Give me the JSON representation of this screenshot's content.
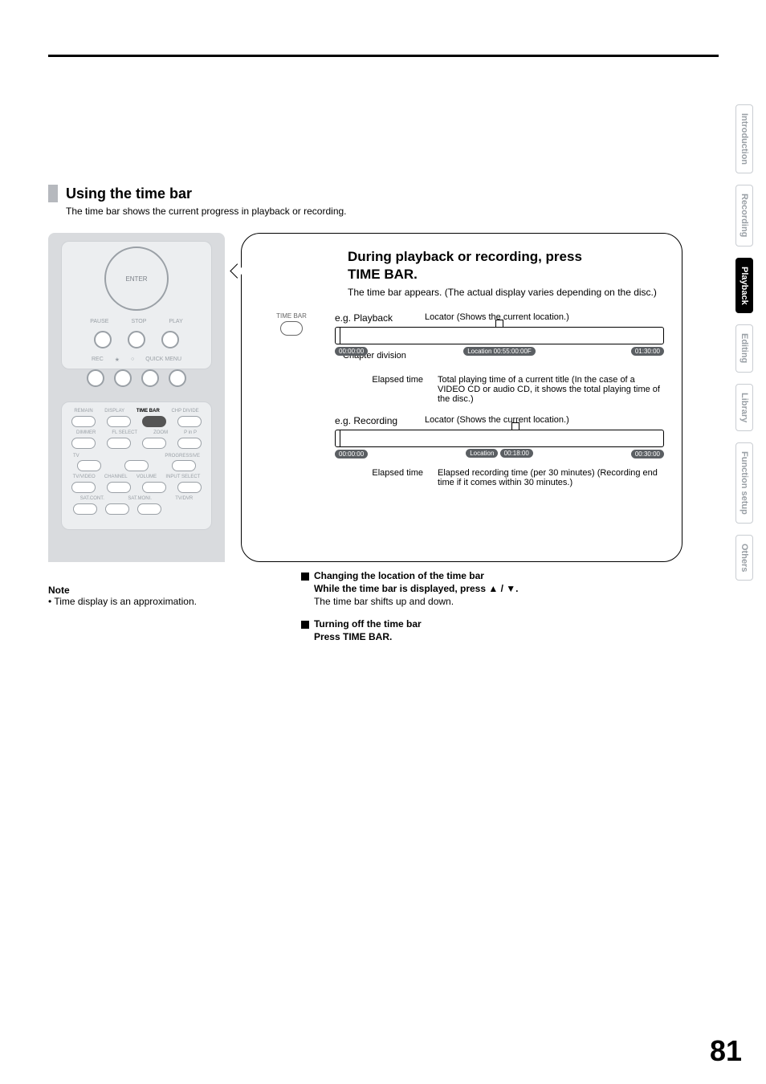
{
  "page_number": "81",
  "side_tabs": {
    "t0": "Introduction",
    "t1": "Recording",
    "t2": "Playback",
    "t3": "Editing",
    "t4": "Library",
    "t5": "Function setup",
    "t6": "Others"
  },
  "section": {
    "title": "Using the time bar",
    "subtitle": "The time bar shows the current progress in playback or recording."
  },
  "remote": {
    "enter": "ENTER",
    "row1": {
      "pause": "PAUSE",
      "stop": "STOP",
      "play": "PLAY"
    },
    "row2": {
      "rec": "REC",
      "star": "",
      "circle": "",
      "quick": "QUICK MENU"
    },
    "lower_r1": {
      "a": "REMAIN",
      "b": "DISPLAY",
      "c": "TIME BAR",
      "d": "CHP DIVIDE"
    },
    "lower_r2": {
      "a": "DIMMER",
      "b": "FL SELECT",
      "c": "ZOOM",
      "d": "P in P"
    },
    "tv": "TV",
    "prog": "PROGRESSIVE",
    "lower_r3": {
      "a": "TV/VIDEO",
      "b": "CHANNEL",
      "c": "VOLUME",
      "d": "INPUT SELECT"
    },
    "lower_r4": {
      "a": "SAT.CONT.",
      "b": "SAT.MONI.",
      "c": "TV/DVR"
    }
  },
  "step": {
    "title_l1": "During playback or recording, press",
    "title_l2": "TIME BAR.",
    "desc": "The time bar appears. (The actual display varies depending on the disc.)",
    "timebar_btn_label": "TIME BAR"
  },
  "playback": {
    "eg": "e.g. Playback",
    "locator": "Locator (Shows the current location.)",
    "start": "00:00:00",
    "mid": "Location 00:55:00:00F",
    "end": "01:30:00",
    "chapter": "Chapter division",
    "elapsed": "Elapsed time",
    "total": "Total playing time of a current title (In the case of a VIDEO CD or audio CD, it shows the total playing time of the disc.)"
  },
  "recording": {
    "eg": "e.g. Recording",
    "locator": "Locator (Shows the current location.)",
    "start": "00:00:00",
    "mid": "Location",
    "mid2": "00:18:00",
    "end": "00:30:00",
    "elapsed": "Elapsed time",
    "total": "Elapsed recording time (per 30 minutes) (Recording end time if it comes within 30 minutes.)"
  },
  "note": {
    "heading": "Note",
    "bullet": "• Time display is an approximation."
  },
  "extras": {
    "change_hd": "Changing the location of the time bar",
    "change_l1": "While the time bar is displayed, press ▲ / ▼.",
    "change_l2": "The time bar shifts up and down.",
    "off_hd": "Turning off the time bar",
    "off_l1": "Press TIME BAR."
  }
}
